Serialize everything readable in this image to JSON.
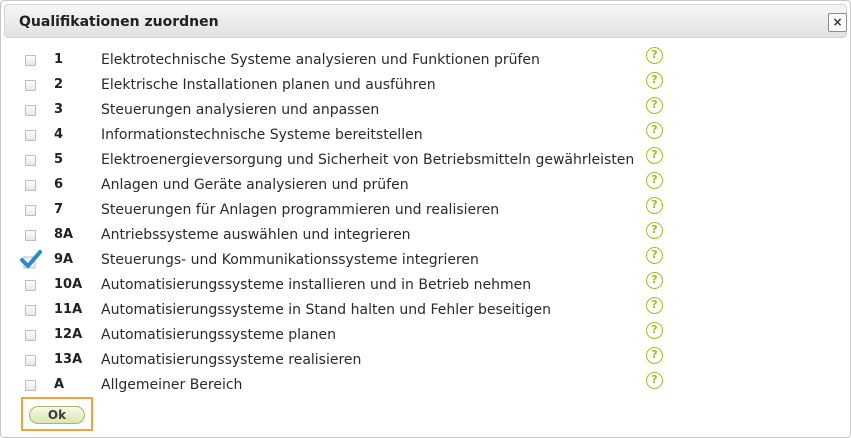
{
  "dialog": {
    "title": "Qualifikationen zuordnen",
    "close_label": "×",
    "help_glyph": "?",
    "ok_label": "Ok"
  },
  "colors": {
    "help_icon": "#9cc31e",
    "check_mark": "#2a8bc9",
    "ok_focus_border": "#f3a13a"
  },
  "qualifications": [
    {
      "num": "1",
      "label": "Elektrotechnische Systeme analysieren und Funktionen prüfen",
      "checked": false
    },
    {
      "num": "2",
      "label": "Elektrische Installationen planen und ausführen",
      "checked": false
    },
    {
      "num": "3",
      "label": "Steuerungen analysieren und anpassen",
      "checked": false
    },
    {
      "num": "4",
      "label": "Informationstechnische Systeme bereitstellen",
      "checked": false
    },
    {
      "num": "5",
      "label": "Elektroenergieversorgung und Sicherheit von Betriebsmitteln gewährleisten",
      "checked": false
    },
    {
      "num": "6",
      "label": "Anlagen und Geräte analysieren und prüfen",
      "checked": false
    },
    {
      "num": "7",
      "label": "Steuerungen für Anlagen programmieren und realisieren",
      "checked": false
    },
    {
      "num": "8A",
      "label": "Antriebssysteme auswählen und integrieren",
      "checked": false
    },
    {
      "num": "9A",
      "label": "Steuerungs- und Kommunikationssysteme integrieren",
      "checked": true
    },
    {
      "num": "10A",
      "label": "Automatisierungssysteme installieren und in Betrieb nehmen",
      "checked": false
    },
    {
      "num": "11A",
      "label": "Automatisierungssysteme in Stand halten und Fehler beseitigen",
      "checked": false
    },
    {
      "num": "12A",
      "label": "Automatisierungssysteme planen",
      "checked": false
    },
    {
      "num": "13A",
      "label": "Automatisierungssysteme realisieren",
      "checked": false
    },
    {
      "num": "A",
      "label": "Allgemeiner Bereich",
      "checked": false
    }
  ]
}
